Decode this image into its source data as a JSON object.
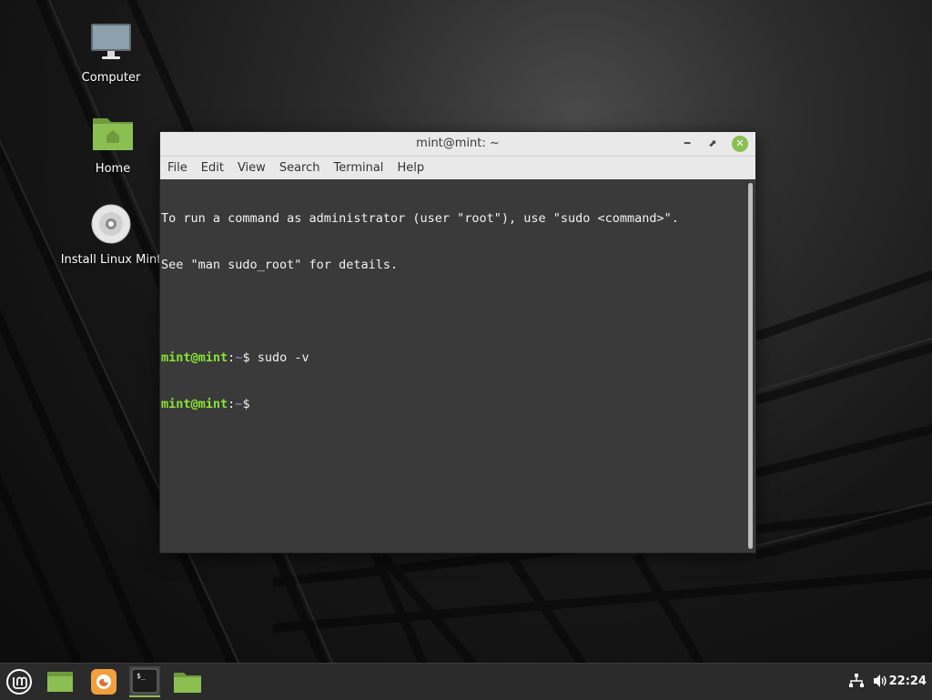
{
  "desktop": {
    "icons": [
      {
        "label": "Computer",
        "icon": "computer-monitor-icon"
      },
      {
        "label": "Home",
        "icon": "home-folder-icon"
      },
      {
        "label": "Install Linux Mint",
        "icon": "disc-icon"
      }
    ]
  },
  "window": {
    "title": "mint@mint: ~",
    "controls": {
      "minimize": "minimize-icon",
      "maximize": "maximize-icon",
      "close": "close-icon"
    },
    "menu": [
      "File",
      "Edit",
      "View",
      "Search",
      "Terminal",
      "Help"
    ]
  },
  "terminal": {
    "motd_1": "To run a command as administrator (user \"root\"), use \"sudo <command>\".",
    "motd_2": "See \"man sudo_root\" for details.",
    "prompt_user": "mint@mint",
    "prompt_sep": ":",
    "prompt_path": "~",
    "prompt_symbol": "$",
    "command_1": " sudo -v",
    "command_2": " "
  },
  "taskbar": {
    "items": [
      "mint-menu-icon",
      "show-desktop-icon",
      "firefox-icon",
      "terminal-icon",
      "files-icon"
    ],
    "tray": [
      "network-icon",
      "volume-icon"
    ],
    "clock": "22:24"
  },
  "colors": {
    "accent": "#8bbf52",
    "prompt_user": "#8ae234",
    "prompt_path": "#729fcf",
    "terminal_bg": "#3a3a3a"
  }
}
